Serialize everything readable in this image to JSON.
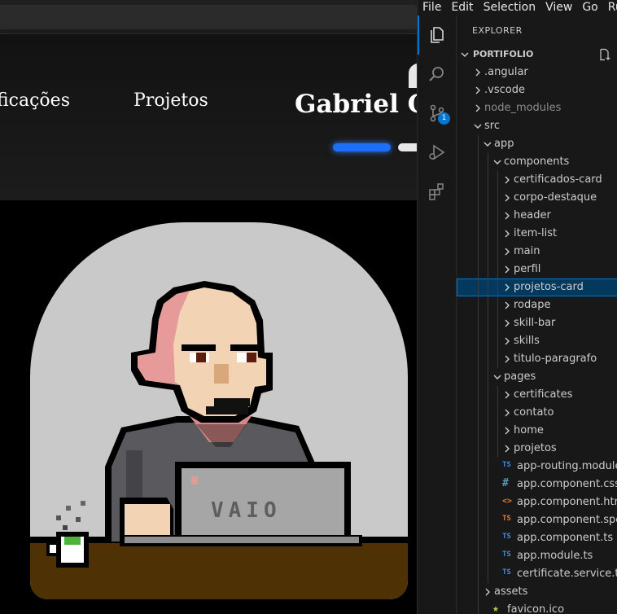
{
  "site": {
    "nav": {
      "certificados": "ficações",
      "projetos": "Projetos"
    },
    "brand_name": "Gabriel C"
  },
  "vscode": {
    "menu": [
      "File",
      "Edit",
      "Selection",
      "View",
      "Go",
      "Ru"
    ],
    "activity_badge": "1",
    "explorer_title": "EXPLORER",
    "workspace": "PORTIFOLIO",
    "tree": [
      {
        "label": ".angular",
        "type": "folder",
        "open": false,
        "depth": 0
      },
      {
        "label": ".vscode",
        "type": "folder",
        "open": false,
        "depth": 0
      },
      {
        "label": "node_modules",
        "type": "folder",
        "open": false,
        "depth": 0,
        "dim": true
      },
      {
        "label": "src",
        "type": "folder",
        "open": true,
        "depth": 0
      },
      {
        "label": "app",
        "type": "folder",
        "open": true,
        "depth": 1
      },
      {
        "label": "components",
        "type": "folder",
        "open": true,
        "depth": 2
      },
      {
        "label": "certificados-card",
        "type": "folder",
        "open": false,
        "depth": 3
      },
      {
        "label": "corpo-destaque",
        "type": "folder",
        "open": false,
        "depth": 3
      },
      {
        "label": "header",
        "type": "folder",
        "open": false,
        "depth": 3
      },
      {
        "label": "item-list",
        "type": "folder",
        "open": false,
        "depth": 3
      },
      {
        "label": "main",
        "type": "folder",
        "open": false,
        "depth": 3
      },
      {
        "label": "perfil",
        "type": "folder",
        "open": false,
        "depth": 3
      },
      {
        "label": "projetos-card",
        "type": "folder",
        "open": false,
        "depth": 3,
        "selected": true
      },
      {
        "label": "rodape",
        "type": "folder",
        "open": false,
        "depth": 3
      },
      {
        "label": "skill-bar",
        "type": "folder",
        "open": false,
        "depth": 3
      },
      {
        "label": "skills",
        "type": "folder",
        "open": false,
        "depth": 3
      },
      {
        "label": "titulo-paragrafo",
        "type": "folder",
        "open": false,
        "depth": 3
      },
      {
        "label": "pages",
        "type": "folder",
        "open": true,
        "depth": 2
      },
      {
        "label": "certificates",
        "type": "folder",
        "open": false,
        "depth": 3
      },
      {
        "label": "contato",
        "type": "folder",
        "open": false,
        "depth": 3
      },
      {
        "label": "home",
        "type": "folder",
        "open": false,
        "depth": 3
      },
      {
        "label": "projetos",
        "type": "folder",
        "open": false,
        "depth": 3
      },
      {
        "label": "app-routing.module.ts",
        "type": "file",
        "icon": "TS",
        "icon_color": "#3b8eea",
        "depth": 2
      },
      {
        "label": "app.component.css",
        "type": "file",
        "icon": "#",
        "icon_color": "#519aba",
        "depth": 2
      },
      {
        "label": "app.component.html",
        "type": "file",
        "icon": "<>",
        "icon_color": "#e37933",
        "depth": 2
      },
      {
        "label": "app.component.spec.ts",
        "type": "file",
        "icon": "TS",
        "icon_color": "#e37933",
        "depth": 2
      },
      {
        "label": "app.component.ts",
        "type": "file",
        "icon": "TS",
        "icon_color": "#3b8eea",
        "depth": 2
      },
      {
        "label": "app.module.ts",
        "type": "file",
        "icon": "TS",
        "icon_color": "#3b8eea",
        "depth": 2
      },
      {
        "label": "certificate.service.ts",
        "type": "file",
        "icon": "TS",
        "icon_color": "#3b8eea",
        "depth": 2
      },
      {
        "label": "assets",
        "type": "folder",
        "open": false,
        "depth": 1
      },
      {
        "label": "favicon.ico",
        "type": "file",
        "icon": "★",
        "icon_color": "#cbcb41",
        "depth": 1
      }
    ]
  }
}
